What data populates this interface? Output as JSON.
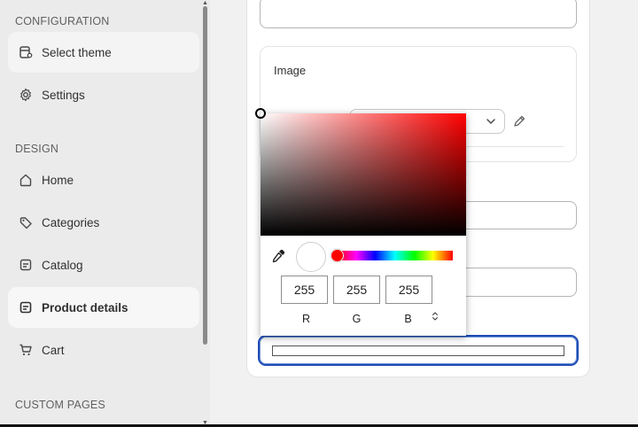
{
  "sidebar": {
    "sections": {
      "configuration": "CONFIGURATION",
      "design": "DESIGN",
      "custom_pages": "CUSTOM PAGES"
    },
    "items": {
      "select_theme": "Select theme",
      "settings": "Settings",
      "home": "Home",
      "categories": "Categories",
      "catalog": "Catalog",
      "product_details": "Product details",
      "cart": "Cart"
    },
    "active_item": "Product details"
  },
  "main": {
    "image_box": {
      "label": "Image"
    }
  },
  "color_picker": {
    "current_color": "#ffffff",
    "hue_color": "#ff0000",
    "rgb": {
      "r": "255",
      "g": "255",
      "b": "255"
    },
    "labels": {
      "r": "R",
      "g": "G",
      "b": "B"
    },
    "mode_toggle_icon": "up-down-chevron-icon"
  },
  "colors": {
    "focus_ring": "#1f4db3",
    "sidebar_bg": "#ebebeb",
    "canvas_bg": "#f1f1f1"
  }
}
